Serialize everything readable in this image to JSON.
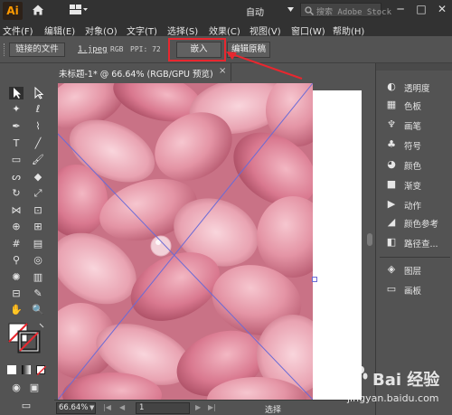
{
  "titlebar": {
    "app_logo": "Ai",
    "workspace_label": "自动",
    "stock_placeholder": "搜索 Adobe Stock",
    "minimize": "─",
    "maximize": "□",
    "close": "✕"
  },
  "menu": [
    "文件(F)",
    "编辑(E)",
    "对象(O)",
    "文字(T)",
    "选择(S)",
    "效果(C)",
    "视图(V)",
    "窗口(W)",
    "帮助(H)"
  ],
  "control": {
    "linked_file": "链接的文件",
    "filename": "1.jpeg",
    "colormode": "RGB",
    "ppi": "PPI: 72",
    "embed": "嵌入",
    "edit_original": "编辑原稿"
  },
  "document": {
    "tab_title": "未标题-1* @ 66.64% (RGB/GPU 预览)",
    "close": "×"
  },
  "status": {
    "zoom": "66.64%",
    "page": "1",
    "tool": "选择",
    "first": "|◀",
    "prev": "◀",
    "next": "▶",
    "last": "▶|"
  },
  "panels": [
    {
      "icon": "transparency-icon",
      "glyph": "◐",
      "label": "透明度"
    },
    {
      "icon": "swatches-icon",
      "glyph": "▦",
      "label": "色板"
    },
    {
      "icon": "brushes-icon",
      "glyph": "♆",
      "label": "画笔"
    },
    {
      "icon": "symbols-icon",
      "glyph": "♣",
      "label": "符号"
    },
    {
      "icon": "color-icon",
      "glyph": "◕",
      "label": "颜色"
    },
    {
      "icon": "gradient-icon",
      "glyph": "■",
      "label": "渐变"
    },
    {
      "icon": "actions-icon",
      "glyph": "▶",
      "label": "动作"
    },
    {
      "icon": "color-guide-icon",
      "glyph": "◢",
      "label": "颜色参考"
    },
    {
      "icon": "pathfinder-icon",
      "glyph": "◧",
      "label": "路径查..."
    },
    {
      "icon": "layers-icon",
      "glyph": "◈",
      "label": "图层"
    },
    {
      "icon": "artboards-icon",
      "glyph": "▭",
      "label": "画板"
    }
  ],
  "watermark": {
    "brand": "Bai 经验",
    "url": "jingyan.baidu.com"
  },
  "colors": {
    "accent_red": "#e8272f",
    "logo_orange": "#ff9a00",
    "image_pink": "#d9899a"
  }
}
